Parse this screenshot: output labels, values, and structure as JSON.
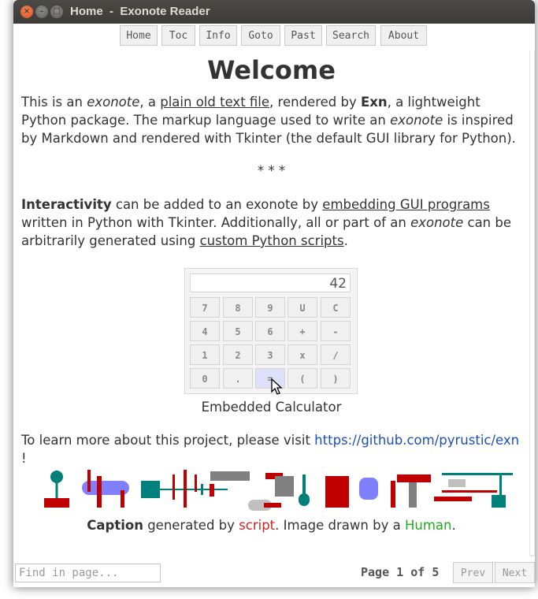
{
  "window": {
    "title": "Home  -  Exonote Reader",
    "close_glyph": "×",
    "minimize_glyph": "–",
    "maximize_glyph": "□"
  },
  "nav": {
    "items": [
      "Home",
      "Toc",
      "Info",
      "Goto",
      "Past",
      "Search",
      "About"
    ]
  },
  "content": {
    "heading": "Welcome",
    "p1": {
      "t1": "This is an ",
      "em1": "exonote",
      "t2": ", a ",
      "link1": "plain old text file",
      "t3": ", rendered by ",
      "b1": "Exn",
      "t4": ", a lightweight Python package. The markup language used to write an ",
      "em2": "exonote",
      "t5": " is inspired by Markdown and rendered with Tkinter (the default GUI library for Python)."
    },
    "separator": "* * *",
    "p2": {
      "b1": "Interactivity",
      "t1": " can be added to an exonote by ",
      "link1": "embedding GUI programs",
      "t2": " written in Python with Tkinter. Additionally, all or part of an ",
      "em1": "exonote",
      "t3": " can be arbitrarily generated using ",
      "link2": "custom Python scripts",
      "t4": "."
    },
    "calculator": {
      "display": "42",
      "keys": [
        [
          "7",
          "8",
          "9",
          "U",
          "C"
        ],
        [
          "4",
          "5",
          "6",
          "+",
          "-"
        ],
        [
          "1",
          "2",
          "3",
          "x",
          "/"
        ],
        [
          "0",
          ".",
          "=",
          "(",
          ")"
        ]
      ],
      "caption": "Embedded Calculator"
    },
    "p3": {
      "t1": "To learn more about this project, please visit ",
      "link": "https://github.com/pyrustic/exn",
      "t2": " !"
    },
    "caption": {
      "b1": "Caption",
      "t1": " generated by ",
      "red": "script",
      "t2": ". Image drawn by a ",
      "green": "Human",
      "t3": "."
    }
  },
  "footer": {
    "find_placeholder": "Find in page...",
    "page_label": "Page",
    "page_current": "1",
    "page_of": "of",
    "page_total": "5",
    "prev": "Prev",
    "next": "Next"
  },
  "colors": {
    "art_red": "#c00000",
    "art_teal": "#00807a",
    "art_blue": "#8080ff",
    "art_gray": "#808080",
    "link_blue": "#1c4fb8"
  }
}
